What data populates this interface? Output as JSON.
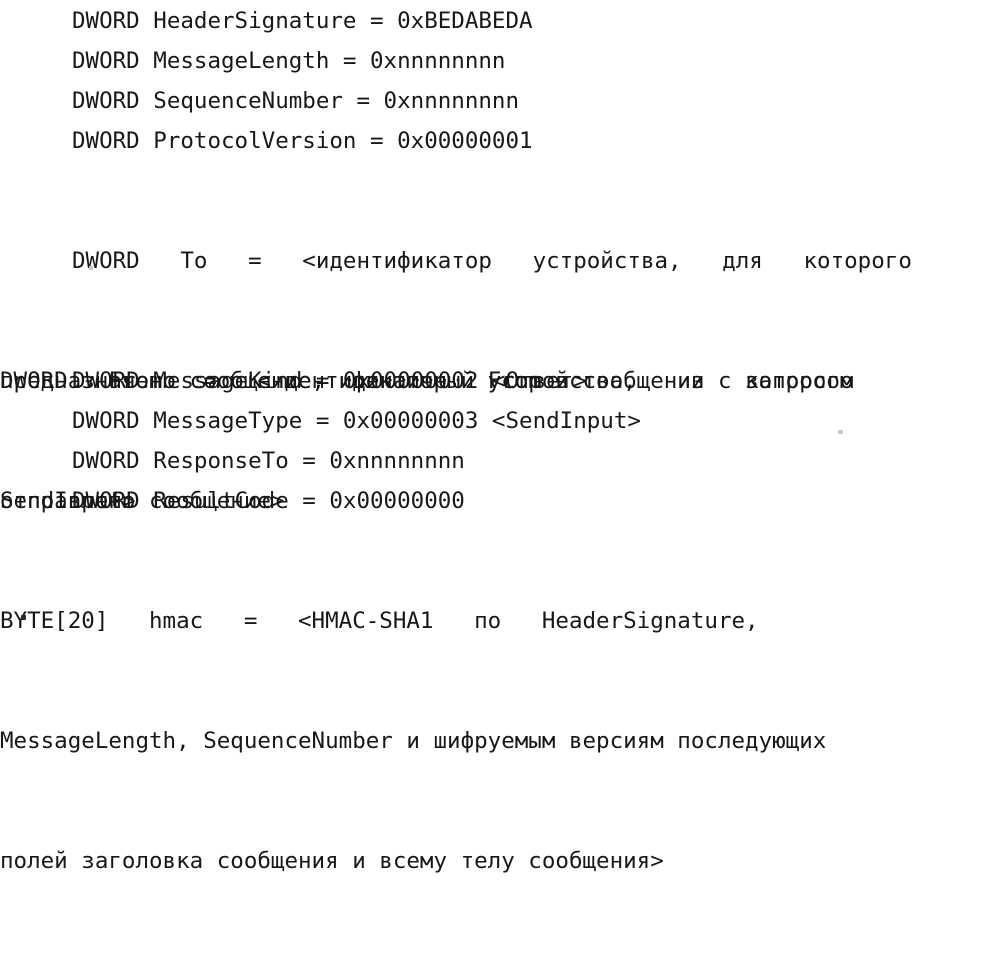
{
  "document": {
    "language": "ru",
    "page_background": "#ffffff",
    "text_color": "#181818",
    "kind": "scanned-specification-page"
  },
  "lines": {
    "header_signature": "DWORD HeaderSignature = 0xBEDABEDA",
    "message_length": "DWORD MessageLength = 0xnnnnnnnn",
    "sequence_number": "DWORD SequenceNumber = 0xnnnnnnnn",
    "protocol_version": "DWORD ProtocolVersion = 0x00000001",
    "message_kind": "DWORD MessageKind = 0x00000002 <Ответ>",
    "message_type": "DWORD MessageType = 0x00000003 <SendInput>",
    "response_to": "DWORD ResponseTo = 0xnnnnnnnn",
    "result_code": "DWORD ResultCode = 0x00000000"
  },
  "paragraphs": {
    "to_field": {
      "lead": "DWORD   To   =   <идентификатор   устройства,   для   которого",
      "middle": "предназначено сообщение, идентичный From в сообщении с запросом",
      "tail": "SendInput>"
    },
    "from_field": {
      "lead": "DWORD   From   =   <идентификатор   устройства,   из   которого",
      "tail": "отправлено сообщение>"
    },
    "hmac_field": {
      "lead": "BYTE[20]   hmac   =   <HMAC-SHA1   по   HeaderSignature,",
      "middle": "MessageLength, SequenceNumber и шифруемым версиям последующих",
      "tail": "полей заголовка сообщения и всему телу сообщения>"
    }
  },
  "artifacts": {
    "stray_dot": "scan-speckle-dot",
    "faint_marks": "scan-speckle-faint"
  }
}
